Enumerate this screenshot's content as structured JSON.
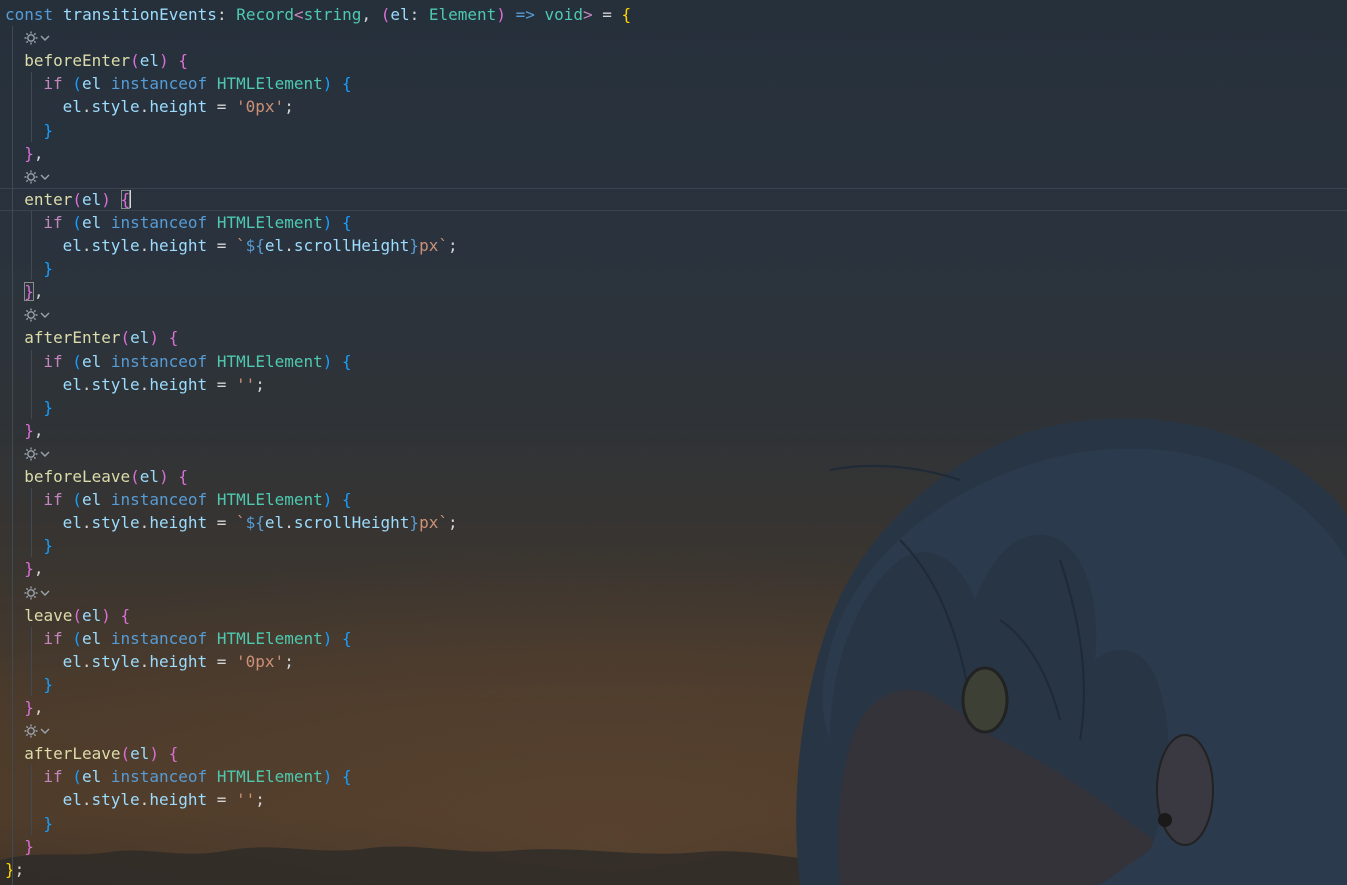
{
  "editor": {
    "lines": [
      {
        "indent": 0,
        "tokens": [
          [
            "const",
            "kw-blue"
          ],
          [
            " ",
            "plain"
          ],
          [
            "transitionEvents",
            "var"
          ],
          [
            ": ",
            "plain"
          ],
          [
            "Record",
            "type"
          ],
          [
            "<",
            "kw-purple"
          ],
          [
            "string",
            "type"
          ],
          [
            ", ",
            "plain"
          ],
          [
            "(",
            "b-pink"
          ],
          [
            "el",
            "var"
          ],
          [
            ": ",
            "plain"
          ],
          [
            "Element",
            "type"
          ],
          [
            ") ",
            "b-pink"
          ],
          [
            "=>",
            "kw-blue"
          ],
          [
            " ",
            "plain"
          ],
          [
            "void",
            "type"
          ],
          [
            "> ",
            "kw-purple"
          ],
          [
            "= ",
            "plain"
          ],
          [
            "{",
            "b-gold"
          ]
        ]
      },
      {
        "lens": true
      },
      {
        "indent": 1,
        "tokens": [
          [
            "beforeEnter",
            "fn"
          ],
          [
            "(",
            "b-pink"
          ],
          [
            "el",
            "var"
          ],
          [
            ") ",
            "b-pink"
          ],
          [
            "{",
            "b-pink"
          ]
        ]
      },
      {
        "indent": 2,
        "tokens": [
          [
            "if",
            "kw-purple"
          ],
          [
            " ",
            "plain"
          ],
          [
            "(",
            "b-blue"
          ],
          [
            "el",
            "var"
          ],
          [
            " ",
            "plain"
          ],
          [
            "instanceof",
            "kw-blue"
          ],
          [
            " ",
            "plain"
          ],
          [
            "HTMLElement",
            "type"
          ],
          [
            ") ",
            "b-blue"
          ],
          [
            "{",
            "b-blue"
          ]
        ]
      },
      {
        "indent": 3,
        "tokens": [
          [
            "el",
            "var"
          ],
          [
            ".",
            "plain"
          ],
          [
            "style",
            "var"
          ],
          [
            ".",
            "plain"
          ],
          [
            "height",
            "var"
          ],
          [
            " = ",
            "plain"
          ],
          [
            "'0px'",
            "str"
          ],
          [
            ";",
            "plain"
          ]
        ]
      },
      {
        "indent": 2,
        "tokens": [
          [
            "}",
            "b-blue"
          ]
        ]
      },
      {
        "indent": 1,
        "tokens": [
          [
            "}",
            "b-pink"
          ],
          [
            ",",
            "plain"
          ]
        ]
      },
      {
        "lens": true
      },
      {
        "indent": 1,
        "current": true,
        "tokens": [
          [
            "enter",
            "fn"
          ],
          [
            "(",
            "b-pink"
          ],
          [
            "el",
            "var"
          ],
          [
            ") ",
            "b-pink"
          ],
          [
            "{",
            "b-pink bm"
          ],
          [
            "|",
            "cursor"
          ]
        ]
      },
      {
        "indent": 2,
        "tokens": [
          [
            "if",
            "kw-purple"
          ],
          [
            " ",
            "plain"
          ],
          [
            "(",
            "b-blue"
          ],
          [
            "el",
            "var"
          ],
          [
            " ",
            "plain"
          ],
          [
            "instanceof",
            "kw-blue"
          ],
          [
            " ",
            "plain"
          ],
          [
            "HTMLElement",
            "type"
          ],
          [
            ") ",
            "b-blue"
          ],
          [
            "{",
            "b-blue"
          ]
        ]
      },
      {
        "indent": 3,
        "tokens": [
          [
            "el",
            "var"
          ],
          [
            ".",
            "plain"
          ],
          [
            "style",
            "var"
          ],
          [
            ".",
            "plain"
          ],
          [
            "height",
            "var"
          ],
          [
            " = ",
            "plain"
          ],
          [
            "`",
            "str"
          ],
          [
            "${",
            "kw-blue"
          ],
          [
            "el",
            "var"
          ],
          [
            ".",
            "plain"
          ],
          [
            "scrollHeight",
            "var"
          ],
          [
            "}",
            "kw-blue"
          ],
          [
            "px`",
            "str"
          ],
          [
            ";",
            "plain"
          ]
        ]
      },
      {
        "indent": 2,
        "tokens": [
          [
            "}",
            "b-blue"
          ]
        ]
      },
      {
        "indent": 1,
        "tokens": [
          [
            "}",
            "b-pink bm"
          ],
          [
            ",",
            "plain"
          ]
        ]
      },
      {
        "lens": true
      },
      {
        "indent": 1,
        "tokens": [
          [
            "afterEnter",
            "fn"
          ],
          [
            "(",
            "b-pink"
          ],
          [
            "el",
            "var"
          ],
          [
            ") ",
            "b-pink"
          ],
          [
            "{",
            "b-pink"
          ]
        ]
      },
      {
        "indent": 2,
        "tokens": [
          [
            "if",
            "kw-purple"
          ],
          [
            " ",
            "plain"
          ],
          [
            "(",
            "b-blue"
          ],
          [
            "el",
            "var"
          ],
          [
            " ",
            "plain"
          ],
          [
            "instanceof",
            "kw-blue"
          ],
          [
            " ",
            "plain"
          ],
          [
            "HTMLElement",
            "type"
          ],
          [
            ") ",
            "b-blue"
          ],
          [
            "{",
            "b-blue"
          ]
        ]
      },
      {
        "indent": 3,
        "tokens": [
          [
            "el",
            "var"
          ],
          [
            ".",
            "plain"
          ],
          [
            "style",
            "var"
          ],
          [
            ".",
            "plain"
          ],
          [
            "height",
            "var"
          ],
          [
            " = ",
            "plain"
          ],
          [
            "''",
            "str"
          ],
          [
            ";",
            "plain"
          ]
        ]
      },
      {
        "indent": 2,
        "tokens": [
          [
            "}",
            "b-blue"
          ]
        ]
      },
      {
        "indent": 1,
        "tokens": [
          [
            "}",
            "b-pink"
          ],
          [
            ",",
            "plain"
          ]
        ]
      },
      {
        "lens": true
      },
      {
        "indent": 1,
        "tokens": [
          [
            "beforeLeave",
            "fn"
          ],
          [
            "(",
            "b-pink"
          ],
          [
            "el",
            "var"
          ],
          [
            ") ",
            "b-pink"
          ],
          [
            "{",
            "b-pink"
          ]
        ]
      },
      {
        "indent": 2,
        "tokens": [
          [
            "if",
            "kw-purple"
          ],
          [
            " ",
            "plain"
          ],
          [
            "(",
            "b-blue"
          ],
          [
            "el",
            "var"
          ],
          [
            " ",
            "plain"
          ],
          [
            "instanceof",
            "kw-blue"
          ],
          [
            " ",
            "plain"
          ],
          [
            "HTMLElement",
            "type"
          ],
          [
            ") ",
            "b-blue"
          ],
          [
            "{",
            "b-blue"
          ]
        ]
      },
      {
        "indent": 3,
        "tokens": [
          [
            "el",
            "var"
          ],
          [
            ".",
            "plain"
          ],
          [
            "style",
            "var"
          ],
          [
            ".",
            "plain"
          ],
          [
            "height",
            "var"
          ],
          [
            " = ",
            "plain"
          ],
          [
            "`",
            "str"
          ],
          [
            "${",
            "kw-blue"
          ],
          [
            "el",
            "var"
          ],
          [
            ".",
            "plain"
          ],
          [
            "scrollHeight",
            "var"
          ],
          [
            "}",
            "kw-blue"
          ],
          [
            "px`",
            "str"
          ],
          [
            ";",
            "plain"
          ]
        ]
      },
      {
        "indent": 2,
        "tokens": [
          [
            "}",
            "b-blue"
          ]
        ]
      },
      {
        "indent": 1,
        "tokens": [
          [
            "}",
            "b-pink"
          ],
          [
            ",",
            "plain"
          ]
        ]
      },
      {
        "lens": true
      },
      {
        "indent": 1,
        "tokens": [
          [
            "leave",
            "fn"
          ],
          [
            "(",
            "b-pink"
          ],
          [
            "el",
            "var"
          ],
          [
            ") ",
            "b-pink"
          ],
          [
            "{",
            "b-pink"
          ]
        ]
      },
      {
        "indent": 2,
        "tokens": [
          [
            "if",
            "kw-purple"
          ],
          [
            " ",
            "plain"
          ],
          [
            "(",
            "b-blue"
          ],
          [
            "el",
            "var"
          ],
          [
            " ",
            "plain"
          ],
          [
            "instanceof",
            "kw-blue"
          ],
          [
            " ",
            "plain"
          ],
          [
            "HTMLElement",
            "type"
          ],
          [
            ") ",
            "b-blue"
          ],
          [
            "{",
            "b-blue"
          ]
        ]
      },
      {
        "indent": 3,
        "tokens": [
          [
            "el",
            "var"
          ],
          [
            ".",
            "plain"
          ],
          [
            "style",
            "var"
          ],
          [
            ".",
            "plain"
          ],
          [
            "height",
            "var"
          ],
          [
            " = ",
            "plain"
          ],
          [
            "'0px'",
            "str"
          ],
          [
            ";",
            "plain"
          ]
        ]
      },
      {
        "indent": 2,
        "tokens": [
          [
            "}",
            "b-blue"
          ]
        ]
      },
      {
        "indent": 1,
        "tokens": [
          [
            "}",
            "b-pink"
          ],
          [
            ",",
            "plain"
          ]
        ]
      },
      {
        "lens": true
      },
      {
        "indent": 1,
        "tokens": [
          [
            "afterLeave",
            "fn"
          ],
          [
            "(",
            "b-pink"
          ],
          [
            "el",
            "var"
          ],
          [
            ") ",
            "b-pink"
          ],
          [
            "{",
            "b-pink"
          ]
        ]
      },
      {
        "indent": 2,
        "tokens": [
          [
            "if",
            "kw-purple"
          ],
          [
            " ",
            "plain"
          ],
          [
            "(",
            "b-blue"
          ],
          [
            "el",
            "var"
          ],
          [
            " ",
            "plain"
          ],
          [
            "instanceof",
            "kw-blue"
          ],
          [
            " ",
            "plain"
          ],
          [
            "HTMLElement",
            "type"
          ],
          [
            ") ",
            "b-blue"
          ],
          [
            "{",
            "b-blue"
          ]
        ]
      },
      {
        "indent": 3,
        "tokens": [
          [
            "el",
            "var"
          ],
          [
            ".",
            "plain"
          ],
          [
            "style",
            "var"
          ],
          [
            ".",
            "plain"
          ],
          [
            "height",
            "var"
          ],
          [
            " = ",
            "plain"
          ],
          [
            "''",
            "str"
          ],
          [
            ";",
            "plain"
          ]
        ]
      },
      {
        "indent": 2,
        "tokens": [
          [
            "}",
            "b-blue"
          ]
        ]
      },
      {
        "indent": 1,
        "tokens": [
          [
            "}",
            "b-pink"
          ]
        ]
      },
      {
        "indent": 0,
        "tokens": [
          [
            "}",
            "b-gold"
          ],
          [
            ";",
            "plain"
          ]
        ]
      }
    ]
  },
  "colors": {
    "keyword": "#569cd6",
    "control": "#c586c0",
    "function": "#dcdcaa",
    "variable": "#9cdcfe",
    "type": "#4ec9b0",
    "string": "#ce9178",
    "bracket1": "#ffd700",
    "bracket2": "#da70d6",
    "bracket3": "#179fff"
  },
  "icons": {
    "codelens": "gear-cog-icon",
    "fold": "chevron-down-icon"
  }
}
